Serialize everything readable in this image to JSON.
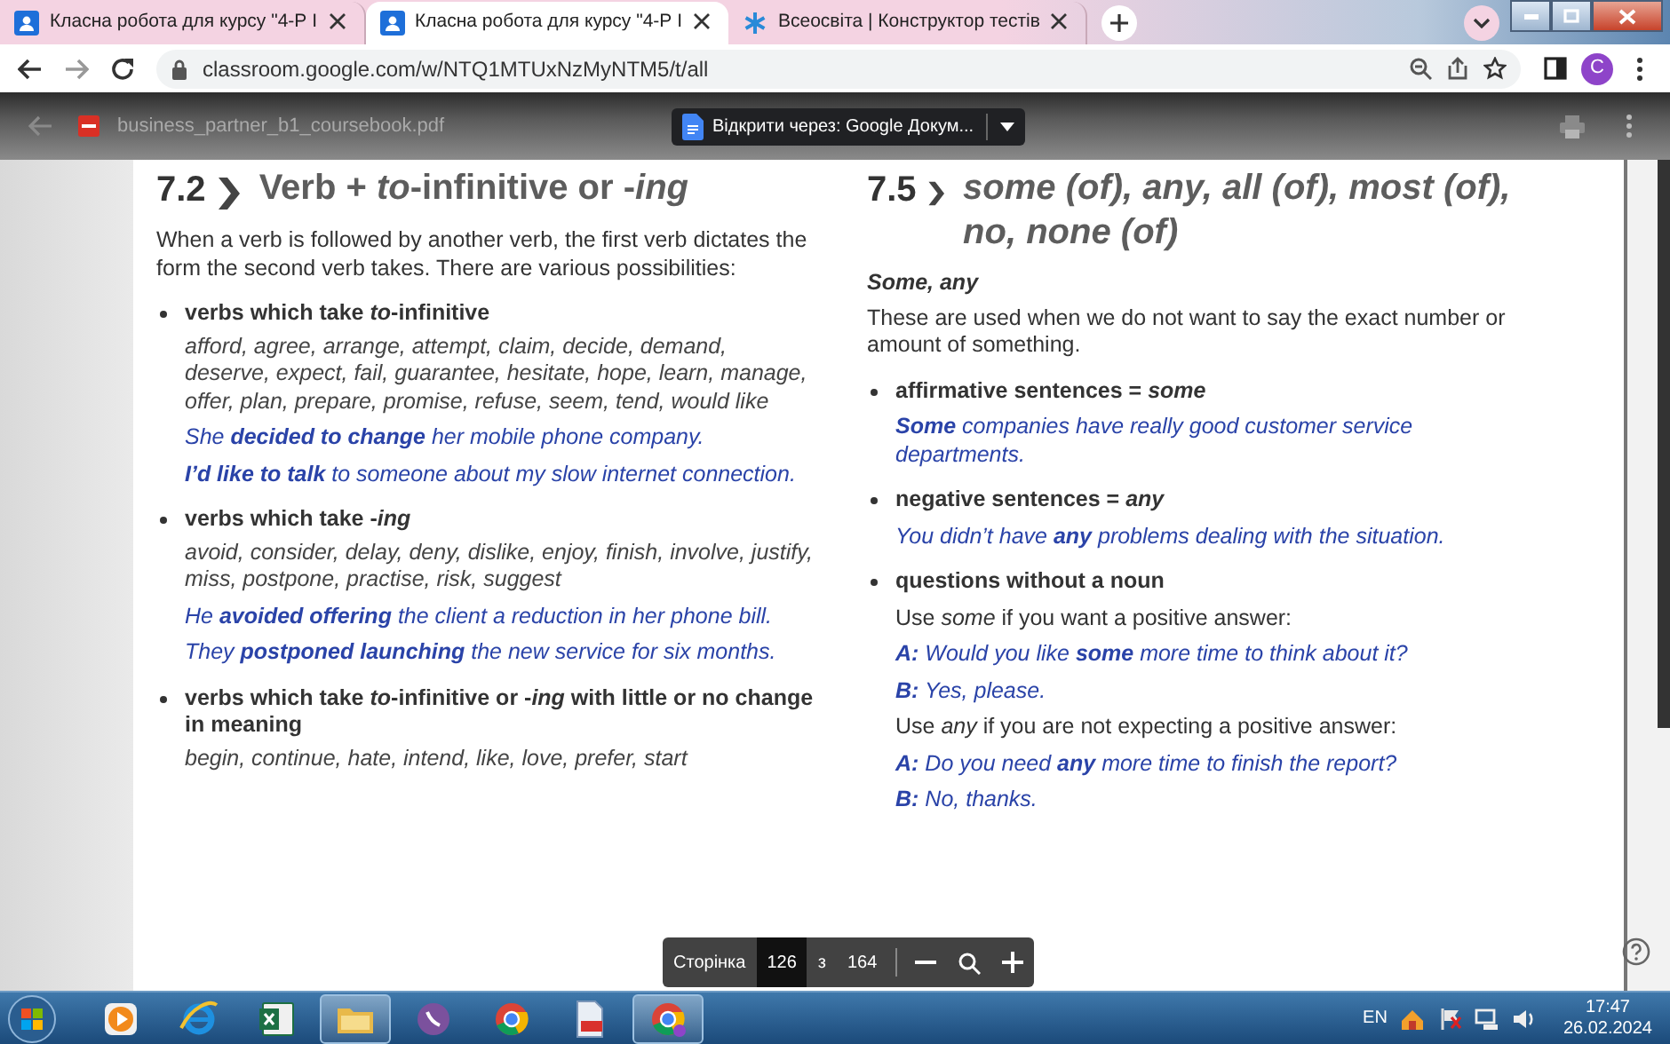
{
  "browser": {
    "tabs": [
      {
        "title": "Класна робота для курсу \"4-Р І",
        "kind": "classroom",
        "selected": false
      },
      {
        "title": "Класна робота для курсу \"4-Р І",
        "kind": "classroom",
        "selected": true
      },
      {
        "title": "Всеосвіта | Конструктор тестів",
        "kind": "test-builder",
        "selected": false
      }
    ],
    "url": "classroom.google.com/w/NTQ1MTUxNzMyNTM5/t/all",
    "profile_initial": "C"
  },
  "pdf_viewer": {
    "filename": "business_partner_b1_coursebook.pdf",
    "open_with": "Відкрити через: Google Докум..."
  },
  "page": {
    "sections": [
      {
        "number": "7.2",
        "title": "Verb + *to*-infinitive or -*ing*",
        "title_italic": false,
        "blocks": [
          {
            "kind": "para",
            "text": "When a verb is followed by another verb, the first verb dictates the form the second verb takes. There are various possibilities:"
          },
          {
            "kind": "bullet",
            "text": "verbs which take *to*-infinitive"
          },
          {
            "kind": "words",
            "text": "afford, agree, arrange, attempt, claim, decide, demand, deserve, expect, fail, guarantee, hesitate, hope, learn, manage, offer, plan, prepare, promise, refuse, seem, tend, would like"
          },
          {
            "kind": "example",
            "text": "She **decided to change** her mobile phone company."
          },
          {
            "kind": "example",
            "text": "**I’d like to talk** to someone about my slow internet connection."
          },
          {
            "kind": "bullet",
            "text": "verbs which take -*ing*"
          },
          {
            "kind": "words",
            "text": "avoid, consider, delay, deny, dislike, enjoy, finish, involve, justify, miss, postpone, practise, risk, suggest"
          },
          {
            "kind": "example",
            "text": "He **avoided offering** the client a reduction in her phone bill."
          },
          {
            "kind": "example",
            "text": "They **postponed launching** the new service for six months."
          },
          {
            "kind": "bullet",
            "text": "verbs which take *to*-infinitive or -*ing* with little or no change in meaning"
          },
          {
            "kind": "words",
            "text": "begin, continue, hate, intend, like, love, prefer, start"
          }
        ]
      },
      {
        "number": "7.5",
        "title": "some (of), any, all (of), most (of), no, none (of)",
        "title_italic": true,
        "blocks": [
          {
            "kind": "subheading",
            "text": "Some, any"
          },
          {
            "kind": "para",
            "text": "These are used when we do not want to say the exact number or amount of something."
          },
          {
            "kind": "bullet",
            "text": "affirmative sentences = *some*"
          },
          {
            "kind": "example",
            "text": "**Some** companies have really good customer service departments."
          },
          {
            "kind": "bullet",
            "text": "negative sentences = *any*"
          },
          {
            "kind": "example",
            "text": "You didn’t have **any** problems dealing with the situation."
          },
          {
            "kind": "bullet",
            "text": "questions without a noun"
          },
          {
            "kind": "note",
            "text": "Use *some* if you want a positive answer:"
          },
          {
            "kind": "example",
            "text": "**A:** Would you like **some** more time to think about it?"
          },
          {
            "kind": "example",
            "text": "**B:** Yes, please."
          },
          {
            "kind": "note",
            "text": "Use *any* if you are not expecting a positive answer:"
          },
          {
            "kind": "example",
            "text": "**A:** Do you need **any** more time to finish the report?"
          },
          {
            "kind": "example",
            "text": "**B:** No, thanks."
          }
        ]
      }
    ]
  },
  "page_toolbar": {
    "label": "Сторінка",
    "current": "126",
    "separator": "з",
    "total": "164"
  },
  "taskbar": {
    "apps": [
      {
        "kind": "media-player",
        "open": false
      },
      {
        "kind": "browser-e",
        "open": false
      },
      {
        "kind": "spreadsheet",
        "open": false
      },
      {
        "kind": "folder",
        "open": true
      },
      {
        "kind": "messenger",
        "open": false
      },
      {
        "kind": "chrome",
        "open": false
      },
      {
        "kind": "pdf",
        "open": false
      },
      {
        "kind": "chrome-profile",
        "open": true
      }
    ],
    "language": "EN",
    "time": "17:47",
    "date": "26.02.2024"
  }
}
